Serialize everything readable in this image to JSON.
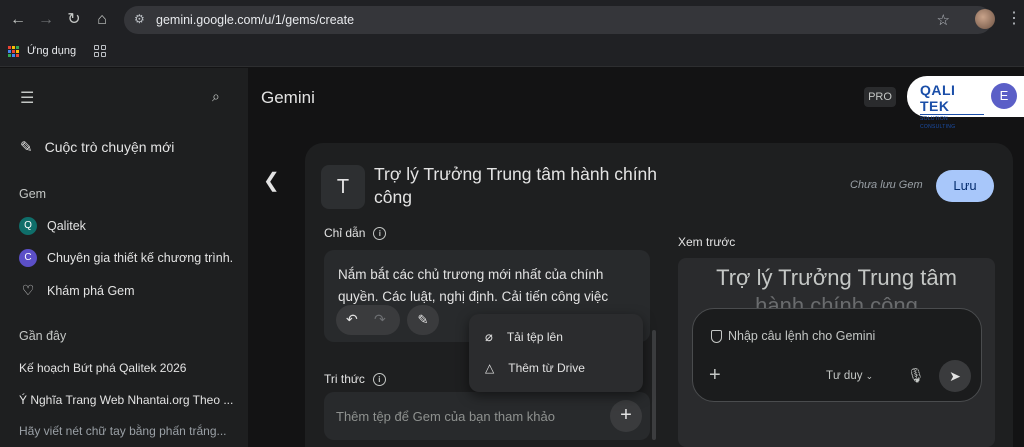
{
  "browser": {
    "url": "gemini.google.com/u/1/gems/create",
    "bookmarks_label": "Ứng dụng"
  },
  "sidebar": {
    "new_chat": "Cuộc trò chuyện mới",
    "gem_section": "Gem",
    "gems": [
      {
        "initial": "Q",
        "label": "Qalitek",
        "color": "#0f6e6a"
      },
      {
        "initial": "C",
        "label": "Chuyên gia thiết kế chương trình...",
        "color": "#5b4fc7"
      }
    ],
    "explore": "Khám phá Gem",
    "recent_section": "Gần đây",
    "recent": [
      "Kế hoạch Bứt phá Qalitek 2026",
      "Ý Nghĩa Trang Web Nhantai.org Theo ...",
      "Hãy viết nét chữ tay bằng phấn trắng..."
    ]
  },
  "header": {
    "app_title": "Gemini",
    "plan_badge": "PRO",
    "logo_main": "QALI TEK",
    "logo_sub": "SOLUTION CONSULTING",
    "avatar_initial": "E"
  },
  "editor": {
    "gem_avatar": "T",
    "gem_name": "Trợ lý Trưởng Trung tâm hành chính công",
    "unsaved_text": "Chưa lưu Gem",
    "save_label": "Lưu",
    "instructions_label": "Chỉ dẫn",
    "instructions_text": "Nắm bắt các chủ trương mới nhất của chính quyền. Các luật, nghị định. Cải tiến công việc",
    "knowledge_label": "Tri thức",
    "knowledge_placeholder": "Thêm tệp để Gem của bạn tham khảo",
    "dropdown": [
      "Tải tệp lên",
      "Thêm từ Drive"
    ]
  },
  "preview": {
    "label": "Xem trước",
    "title_line1": "Trợ lý Trưởng Trung tâm",
    "title_line2": "hành chính công",
    "prompt_placeholder": "Nhập câu lệnh cho Gemini",
    "mode": "Tư duy"
  }
}
